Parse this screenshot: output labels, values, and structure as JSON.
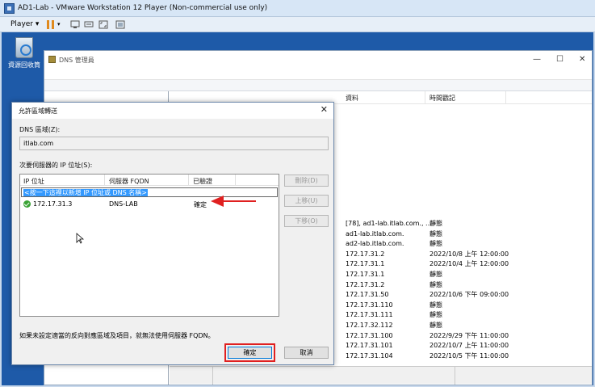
{
  "vm": {
    "title": "AD1-Lab - VMware Workstation 12 Player (Non-commercial use only)",
    "player_menu": "Player"
  },
  "desktop": {
    "recycle_bin_label": "資源回收筒"
  },
  "dns_manager": {
    "title": "DNS 管理員",
    "list_columns": [
      "資料",
      "時間戳記"
    ],
    "rows": [
      {
        "data": "[78], ad1-lab.itlab.com., ...",
        "ts": "靜態"
      },
      {
        "data": "ad1-lab.itlab.com.",
        "ts": "靜態"
      },
      {
        "data": "ad2-lab.itlab.com.",
        "ts": "靜態"
      },
      {
        "data": "172.17.31.2",
        "ts": "2022/10/8 上午 12:00:00"
      },
      {
        "data": "172.17.31.1",
        "ts": "2022/10/4 上午 12:00:00"
      },
      {
        "data": "172.17.31.1",
        "ts": "靜態"
      },
      {
        "data": "172.17.31.2",
        "ts": "靜態"
      },
      {
        "data": "172.17.31.50",
        "ts": "2022/10/6 下午 09:00:00"
      },
      {
        "data": "172.17.31.110",
        "ts": "靜態"
      },
      {
        "data": "172.17.31.111",
        "ts": "靜態"
      },
      {
        "data": "172.17.32.112",
        "ts": "靜態"
      },
      {
        "data": "172.17.31.100",
        "ts": "2022/9/29 下午 11:00:00"
      },
      {
        "data": "172.17.31.101",
        "ts": "2022/10/7 上午 11:00:00"
      },
      {
        "data": "172.17.31.104",
        "ts": "2022/10/5 下午 11:00:00"
      }
    ]
  },
  "dialog": {
    "title": "允許區域轉送",
    "zone_label": "DNS 區域(Z):",
    "zone_value": "itlab.com",
    "servers_label": "次要伺服器的 IP 位址(S):",
    "columns": {
      "ip": "IP 位址",
      "fqdn": "伺服器 FQDN",
      "validated": "已驗證"
    },
    "placeholder_row": "<按一下這裡以新增 IP 位址或 DNS 名稱>",
    "server": {
      "ip": "172.17.31.3",
      "fqdn": "DNS-LAB",
      "validated": "確定"
    },
    "buttons": {
      "delete": "刪除(D)",
      "up": "上移(U)",
      "down": "下移(O)",
      "ok": "確定",
      "cancel": "取消"
    },
    "footnote": "如果未設定適當的反向對應區域及項目，就無法使用伺服器 FQDN。"
  },
  "colors": {
    "highlight_red": "#e02020",
    "selection_blue": "#3399ff",
    "desktop_blue": "#1e5aa8"
  }
}
